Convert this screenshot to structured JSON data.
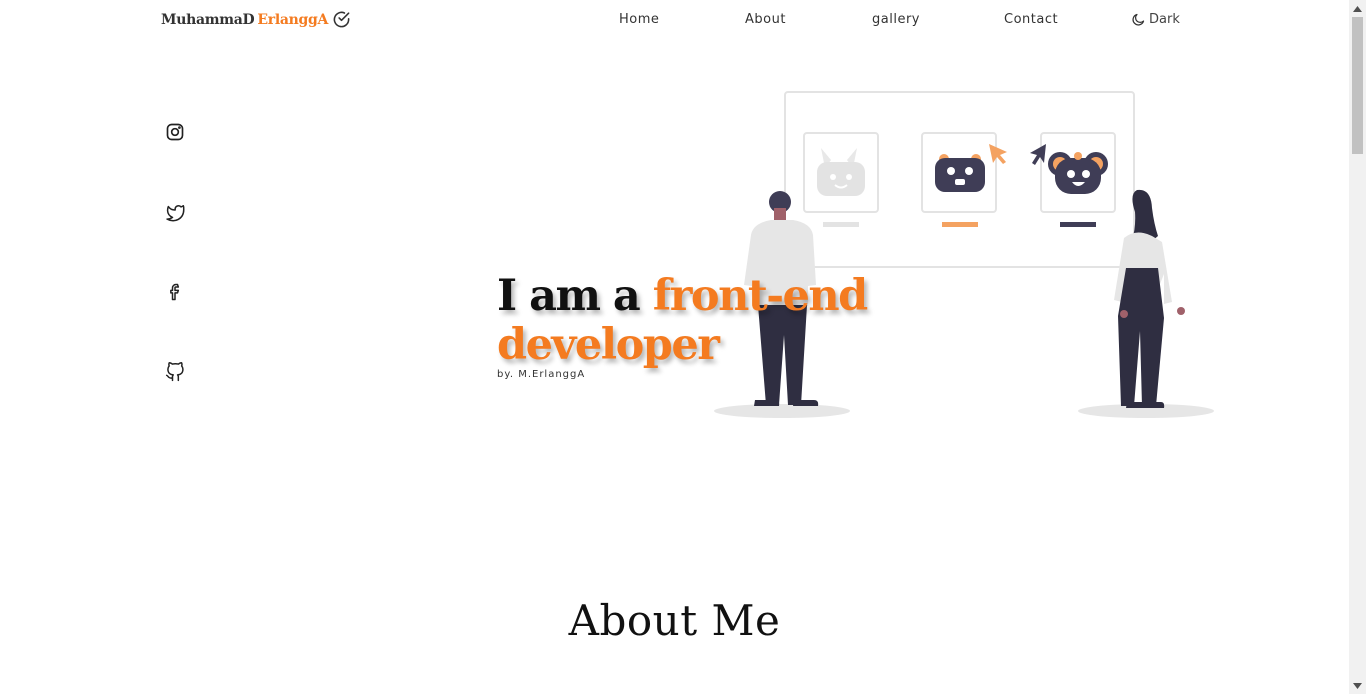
{
  "logo": {
    "first": "MuhammaD",
    "second": "ErlanggA",
    "icon": "check-circle-icon"
  },
  "nav": {
    "links": [
      "Home",
      "About",
      "gallery",
      "Contact"
    ],
    "theme_toggle": {
      "label": "Dark",
      "icon": "moon-icon"
    }
  },
  "socials": [
    "instagram-icon",
    "twitter-icon",
    "facebook-icon",
    "github-icon"
  ],
  "hero": {
    "line1_dark": "I am a ",
    "line1_accent": "front-end",
    "line2_accent": "developer",
    "byline": "by. M.ErlanggA"
  },
  "about": {
    "title": "About Me"
  },
  "colors": {
    "accent": "#f47b20",
    "text": "#111111",
    "figure_dark": "#2f2e41"
  }
}
